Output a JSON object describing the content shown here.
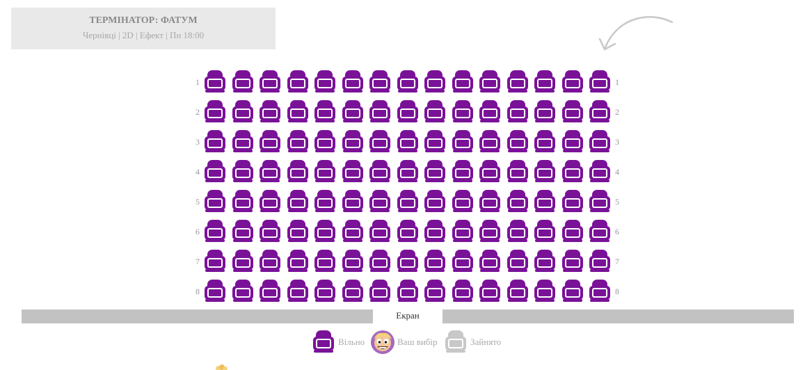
{
  "film": {
    "title": "ТЕРМІНАТОР: ФАТУМ",
    "details": "Чернівці | 2D | Ефект | Пн 18:00"
  },
  "hall": {
    "rows": [
      1,
      2,
      3,
      4,
      5,
      6,
      7,
      8
    ],
    "seats_per_row": 15,
    "all_seats_status": "free"
  },
  "screen": {
    "label": "Екран"
  },
  "legend": {
    "free": "Вільно",
    "selected": "Ваш вибір",
    "taken": "Зайнято"
  },
  "colors": {
    "free": "#7a1298",
    "taken": "#c8c8c8",
    "info_bg": "#e9e9e9",
    "screen_bar": "#c2c2c2",
    "selected_bg": "#a569bd"
  },
  "icons": {
    "seat": "armchair-icon",
    "selected": "popcorn-character-icon",
    "hint": "curved-arrow-icon"
  }
}
